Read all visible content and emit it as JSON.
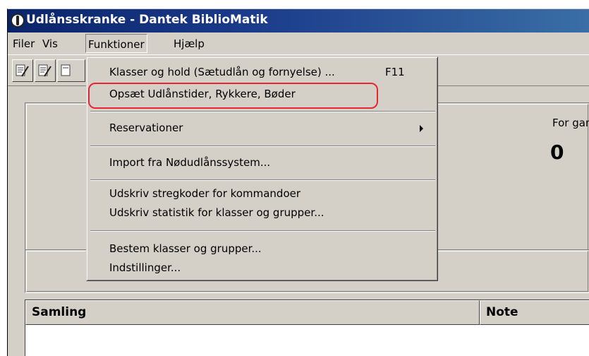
{
  "window": {
    "title": "Udlånsskranke - Dantek BiblioMatik",
    "app_icon": "bibliomatik-app-icon"
  },
  "menubar": {
    "items": [
      {
        "label": "Filer"
      },
      {
        "label": "Vis"
      },
      {
        "label": "Funktioner"
      },
      {
        "label": "Hjælp"
      }
    ]
  },
  "toolbar": {
    "buttons": [
      {
        "icon": "edit-record-icon"
      },
      {
        "icon": "edit-record-icon"
      },
      {
        "icon": "edit-record-icon"
      }
    ]
  },
  "dropdown": {
    "items": [
      {
        "label": "Klasser og hold  (Sætudlån og fornyelse) ...",
        "shortcut": "F11"
      },
      {
        "label": "Opsæt Udlånstider, Rykkere, Bøder"
      },
      {
        "label": "Reservationer",
        "submenu": true
      },
      {
        "label": "Import fra Nødudlånssystem..."
      },
      {
        "label": "Udskriv stregkoder for kommandoer"
      },
      {
        "label": "Udskriv statistik for klasser og grupper..."
      },
      {
        "label": "Bestem klasser og grupper..."
      },
      {
        "label": "Indstillinger..."
      }
    ],
    "highlight_color": "#e8262f"
  },
  "stats": {
    "label": "For gamle",
    "value": "0"
  },
  "grid": {
    "columns": [
      "Samling",
      "Note"
    ]
  },
  "colors": {
    "titlebar": "#0a246a",
    "face": "#d4d0c8"
  }
}
